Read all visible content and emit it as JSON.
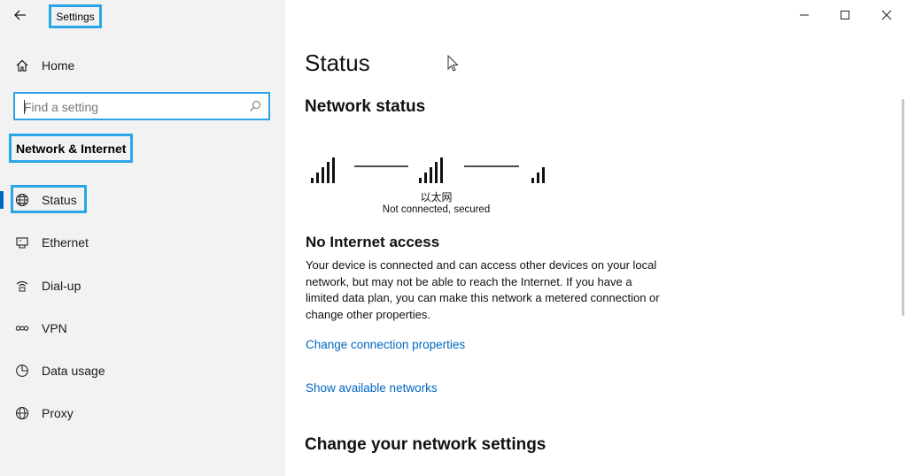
{
  "window": {
    "title": "Settings",
    "controls": [
      "minimize",
      "maximize",
      "close"
    ]
  },
  "sidebar": {
    "home_label": "Home",
    "search": {
      "placeholder": "Find a setting"
    },
    "section_title": "Network & Internet",
    "items": [
      {
        "label": "Status",
        "icon": "globe-status-icon",
        "selected": true
      },
      {
        "label": "Ethernet",
        "icon": "ethernet-icon"
      },
      {
        "label": "Dial-up",
        "icon": "dial-up-icon"
      },
      {
        "label": "VPN",
        "icon": "vpn-icon"
      },
      {
        "label": "Data usage",
        "icon": "data-usage-icon"
      },
      {
        "label": "Proxy",
        "icon": "globe-icon"
      }
    ]
  },
  "main": {
    "title": "Status",
    "network_status_heading": "Network status",
    "diagram": {
      "adapter_name": "以太网",
      "connection_state": "Not connected, secured"
    },
    "no_internet_heading": "No Internet access",
    "description": "Your device is connected and can access other devices on your local network, but may not be able to reach the Internet. If you have a limited data plan, you can make this network a metered connection or change other properties.",
    "links": {
      "change_properties": "Change connection properties",
      "show_networks": "Show available networks"
    },
    "change_settings_heading": "Change your network settings"
  },
  "colors": {
    "accent": "#0067c0",
    "highlight_box": "#2aa6e8",
    "sidebar_bg": "#f2f2f2"
  }
}
